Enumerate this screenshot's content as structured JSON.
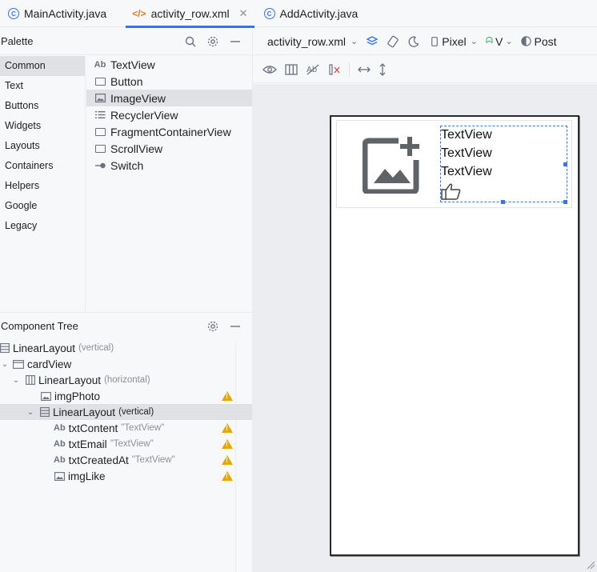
{
  "tabs": [
    {
      "label": "MainActivity.java",
      "icon": "java-class-icon",
      "active": false
    },
    {
      "label": "activity_row.xml",
      "icon": "xml-layout-icon",
      "active": true
    },
    {
      "label": "AddActivity.java",
      "icon": "java-class-icon",
      "active": false
    }
  ],
  "palette": {
    "title": "Palette",
    "categories": [
      "Common",
      "Text",
      "Buttons",
      "Widgets",
      "Layouts",
      "Containers",
      "Helpers",
      "Google",
      "Legacy"
    ],
    "selected_category": "Common",
    "widgets": [
      {
        "label": "TextView",
        "icon": "textview-icon"
      },
      {
        "label": "Button",
        "icon": "button-icon"
      },
      {
        "label": "ImageView",
        "icon": "imageview-icon"
      },
      {
        "label": "RecyclerView",
        "icon": "recyclerview-icon"
      },
      {
        "label": "FragmentContainerView",
        "icon": "fragment-icon"
      },
      {
        "label": "ScrollView",
        "icon": "scrollview-icon"
      },
      {
        "label": "Switch",
        "icon": "switch-icon"
      }
    ],
    "selected_widget": "ImageView"
  },
  "component_tree": {
    "title": "Component Tree",
    "rows": [
      {
        "label": "LinearLayout",
        "sub": "(vertical)"
      },
      {
        "label": "cardView",
        "sub": ""
      },
      {
        "label": "LinearLayout",
        "sub": "(horizontal)"
      },
      {
        "label": "imgPhoto",
        "sub": ""
      },
      {
        "label": "LinearLayout",
        "sub": "(vertical)"
      },
      {
        "label": "txtContent",
        "sub": "\"TextView\""
      },
      {
        "label": "txtEmail",
        "sub": "\"TextView\""
      },
      {
        "label": "txtCreatedAt",
        "sub": "\"TextView\""
      },
      {
        "label": "imgLike",
        "sub": ""
      }
    ]
  },
  "design_toolbar": {
    "file": "activity_row.xml",
    "device": "Pixel",
    "api": "V",
    "theme": "Post"
  },
  "preview": {
    "textviews": [
      "TextView",
      "TextView",
      "TextView"
    ]
  },
  "colors": {
    "accent": "#3574f0",
    "warning": "#e6a700",
    "selection": "#dfe1e5"
  }
}
